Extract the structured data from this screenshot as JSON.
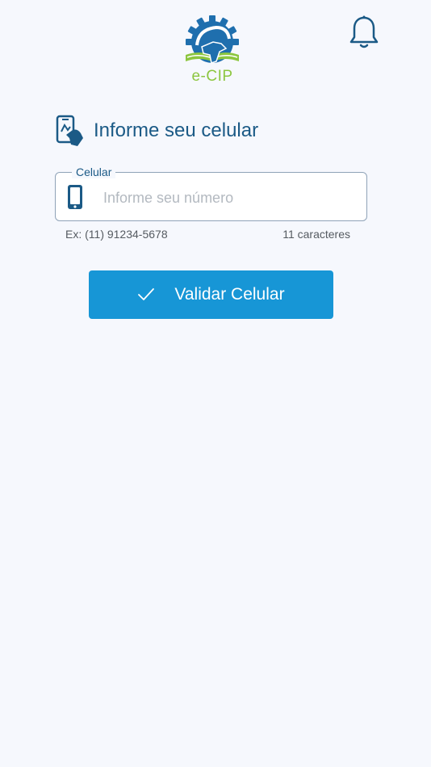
{
  "header": {
    "logo_text": "e-CIP",
    "logo_icon": "e-cip-logo-icon",
    "notification_icon": "bell-icon"
  },
  "section": {
    "icon": "phone-hand-icon",
    "title": "Informe seu celular"
  },
  "phone_field": {
    "label": "Celular",
    "icon": "smartphone-icon",
    "placeholder": "Informe seu número",
    "value": "",
    "example_hint": "Ex: (11) 91234-5678",
    "length_hint": "11 caracteres"
  },
  "validate_button": {
    "label": "Validar Celular",
    "icon": "check-icon"
  },
  "colors": {
    "background": "#f6f8fd",
    "primary_text": "#1b5a86",
    "button": "#1796d6",
    "logo_green": "#8cc63f",
    "logo_blue": "#1f6fae"
  }
}
